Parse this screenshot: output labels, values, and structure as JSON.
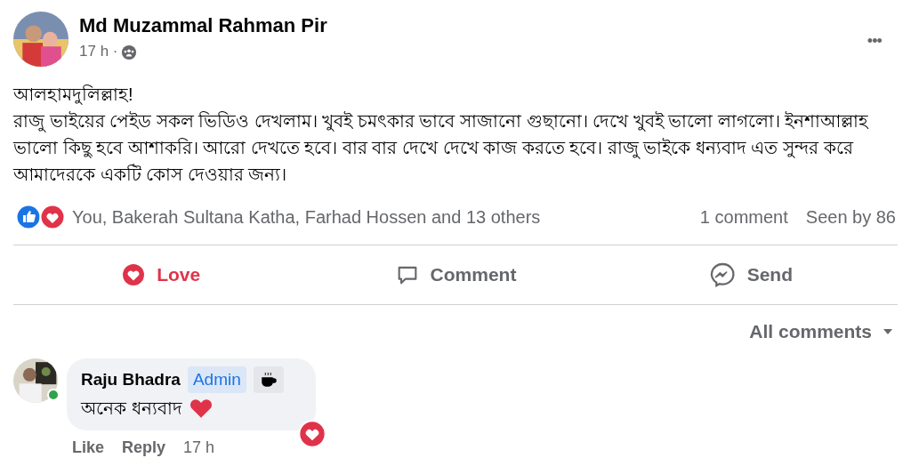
{
  "post": {
    "author": "Md Muzammal Rahman Pir",
    "time": "17 h ·",
    "menu": "•••",
    "body": [
      "আলহামদুলিল্লাহ!",
      "রাজু ভাইয়ের পেইড সকল ভিডিও দেখলাম। খুবই চমৎকার ভাবে সাজানো গুছানো। দেখে খুবই ভালো লাগলো। ইনশাআল্লাহ ভালো কিছু হবে আশাকরি। আরো দেখতে হবে। বার বার দেখে দেখে কাজ করতে হবে। রাজু ভাইকে ধন্যবাদ এত সুন্দর করে আমাদেরকে একটি কোস দেওয়ার জন্য।"
    ],
    "reactions": "You, Bakerah Sultana Katha, Farhad Hossen and 13 others",
    "comments_count": "1 comment",
    "seen": "Seen by 86"
  },
  "actions": [
    {
      "kind": "love",
      "label": "Love",
      "selected": true
    },
    {
      "kind": "comment",
      "label": "Comment",
      "selected": false
    },
    {
      "kind": "send",
      "label": "Send",
      "selected": false
    }
  ],
  "sort": "All comments",
  "comments": [
    {
      "author": "Raju Bhadra",
      "badge": "Admin",
      "online": true,
      "text": "অনেক ধন্যবাদ",
      "loved": true,
      "actions": [
        "Like",
        "Reply"
      ],
      "time": "17 h"
    }
  ]
}
